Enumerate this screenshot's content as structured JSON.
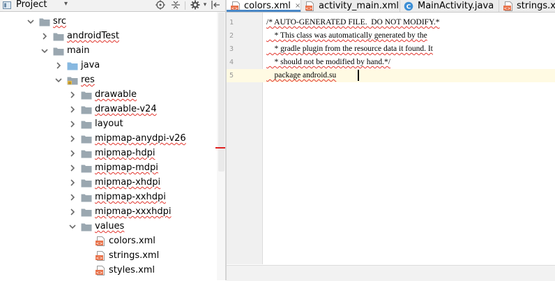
{
  "project_panel": {
    "title": "Project",
    "dropdown_icon": "dropdown-arrow-icon",
    "toolbar_icons": [
      "target-scroll-icon",
      "collapse-all-icon",
      "gear-icon",
      "hide-panel-icon"
    ],
    "tree": [
      {
        "label": "src",
        "depth": 0,
        "expanded": true,
        "icon": "folder-icon"
      },
      {
        "label": "androidTest",
        "depth": 1,
        "expanded": false,
        "icon": "folder-icon"
      },
      {
        "label": "main",
        "depth": 1,
        "expanded": true,
        "icon": "folder-icon"
      },
      {
        "label": "java",
        "depth": 2,
        "expanded": false,
        "icon": "java-source-folder-icon"
      },
      {
        "label": "res",
        "depth": 2,
        "expanded": true,
        "icon": "resource-folder-icon"
      },
      {
        "label": "drawable",
        "depth": 3,
        "expanded": false,
        "icon": "folder-icon"
      },
      {
        "label": "drawable-v24",
        "depth": 3,
        "expanded": false,
        "icon": "folder-icon"
      },
      {
        "label": "layout",
        "depth": 3,
        "expanded": false,
        "icon": "folder-icon"
      },
      {
        "label": "mipmap-anydpi-v26",
        "depth": 3,
        "expanded": false,
        "icon": "folder-icon"
      },
      {
        "label": "mipmap-hdpi",
        "depth": 3,
        "expanded": false,
        "icon": "folder-icon"
      },
      {
        "label": "mipmap-mdpi",
        "depth": 3,
        "expanded": false,
        "icon": "folder-icon"
      },
      {
        "label": "mipmap-xhdpi",
        "depth": 3,
        "expanded": false,
        "icon": "folder-icon"
      },
      {
        "label": "mipmap-xxhdpi",
        "depth": 3,
        "expanded": false,
        "icon": "folder-icon"
      },
      {
        "label": "mipmap-xxxhdpi",
        "depth": 3,
        "expanded": false,
        "icon": "folder-icon"
      },
      {
        "label": "values",
        "depth": 3,
        "expanded": true,
        "icon": "folder-icon"
      },
      {
        "label": "colors.xml",
        "depth": 4,
        "icon": "xml-file-icon"
      },
      {
        "label": "strings.xml",
        "depth": 4,
        "icon": "xml-file-icon"
      },
      {
        "label": "styles.xml",
        "depth": 4,
        "icon": "xml-file-icon"
      }
    ]
  },
  "editor": {
    "tabs": [
      {
        "label": "colors.xml",
        "icon": "xml-file-icon",
        "active": true,
        "closable": true
      },
      {
        "label": "activity_main.xml",
        "icon": "layout-file-icon",
        "active": false,
        "closable": true
      },
      {
        "label": "MainActivity.java",
        "icon": "java-class-icon",
        "active": false,
        "closable": true
      },
      {
        "label": "strings.xml",
        "icon": "xml-file-icon",
        "active": false,
        "closable": false
      }
    ],
    "close_glyph": "×",
    "line_numbers": [
      "1",
      "2",
      "3",
      "4",
      "5"
    ],
    "current_line": 5,
    "lines": [
      "/* AUTO-GENERATED FILE.  DO NOT MODIFY.*",
      "    * This class was automatically generated by the",
      "    * gradle plugin from the resource data it found. It",
      "    * should not be modified by hand.*/",
      "    package android.su"
    ]
  },
  "colors": {
    "accent": "#4a88c7",
    "folder": "#9aa7b0",
    "java_folder": "#87b8e0",
    "xml_icon": "#e8724a",
    "error_underline": "#e2342c",
    "current_line": "#fffae3"
  }
}
